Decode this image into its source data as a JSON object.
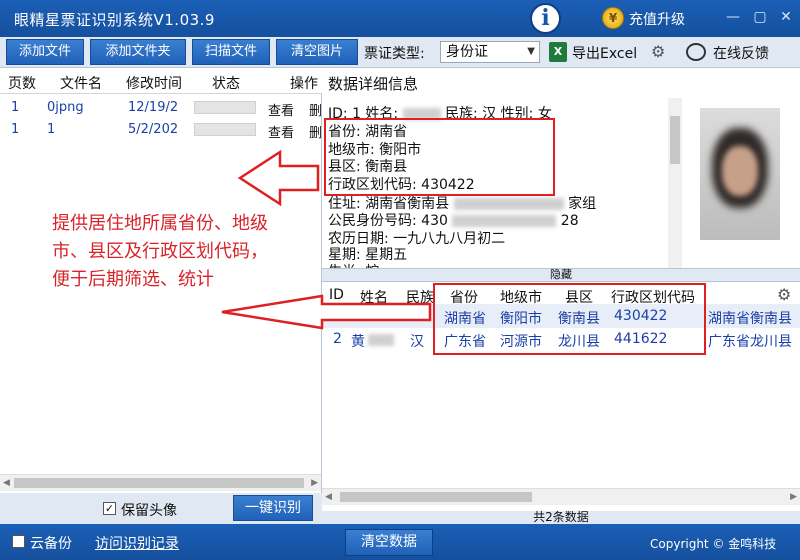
{
  "window": {
    "title": "眼精星票证识别系统V1.03.9",
    "info_glyph": "i",
    "recharge_label": "充值升级",
    "coin_glyph": "¥",
    "minimize": "—",
    "maximize": "▢",
    "close": "✕"
  },
  "toolbar": {
    "add_file": "添加文件",
    "add_folder": "添加文件夹",
    "scan_file": "扫描文件",
    "clear_images": "清空图片",
    "doc_type_label": "票证类型:",
    "doc_type_value": "身份证",
    "export_excel": "导出Excel",
    "excel_glyph": "X",
    "online_feedback": "在线反馈"
  },
  "file_list": {
    "columns": [
      "页数",
      "文件名",
      "修改时间",
      "状态",
      "操作"
    ],
    "rows": [
      {
        "page": "1",
        "filename": "0jpng",
        "modified": "12/19/2",
        "view": "查看",
        "delete": "删"
      },
      {
        "page": "1",
        "filename": "1",
        "modified": "5/2/202",
        "view": "查看",
        "delete": "删"
      }
    ]
  },
  "annotation": {
    "text": "提供居住地所属省份、地级市、县区及行政区划代码，便于后期筛选、统计"
  },
  "left_bottom": {
    "keep_avatar_label": "保留头像",
    "keep_avatar_checked": true,
    "one_click_recognize": "一键识别"
  },
  "detail": {
    "title": "数据详细信息",
    "line_id": "ID: 1 姓名:",
    "ethnicity": "民族: 汉 性别: 女",
    "province": "省份: 湖南省",
    "city": "地级市: 衡阳市",
    "county": "县区: 衡南县",
    "admin_code": "行政区划代码: 430422",
    "address_prefix": "住址: 湖南省衡南县",
    "address_suffix": "家组",
    "id_number_prefix": "公民身份号码: 430",
    "id_number_suffix": "28",
    "lunar_date": "农历日期: 一九八九八月初二",
    "weekday": "星期: 星期五",
    "zodiac": "生肖: 蛇"
  },
  "hide_bar": {
    "label": "隐藏"
  },
  "result_table": {
    "columns": [
      "ID",
      "姓名",
      "民族",
      "省份",
      "地级市",
      "县区",
      "行政区划代码"
    ],
    "rows": [
      {
        "id": "",
        "name": "",
        "ethnicity": "",
        "province": "湖南省",
        "city": "衡阳市",
        "county": "衡南县",
        "code": "430422",
        "extra": "湖南省衡南县"
      },
      {
        "id": "2",
        "name": "黄",
        "ethnicity": "汉",
        "province": "广东省",
        "city": "河源市",
        "county": "龙川县",
        "code": "441622",
        "extra": "广东省龙川县"
      }
    ]
  },
  "status": {
    "count_text": "共2条数据"
  },
  "footer": {
    "cloud_backup_label": "云备份",
    "cloud_backup_checked": true,
    "visit_records": "访问识别记录",
    "clear_data": "清空数据",
    "copyright": "Copyright © 金鸣科技"
  },
  "colors": {
    "brand_blue": "#1b5fb6",
    "annotation_red": "#d8232a",
    "highlight_red": "#e02020"
  }
}
